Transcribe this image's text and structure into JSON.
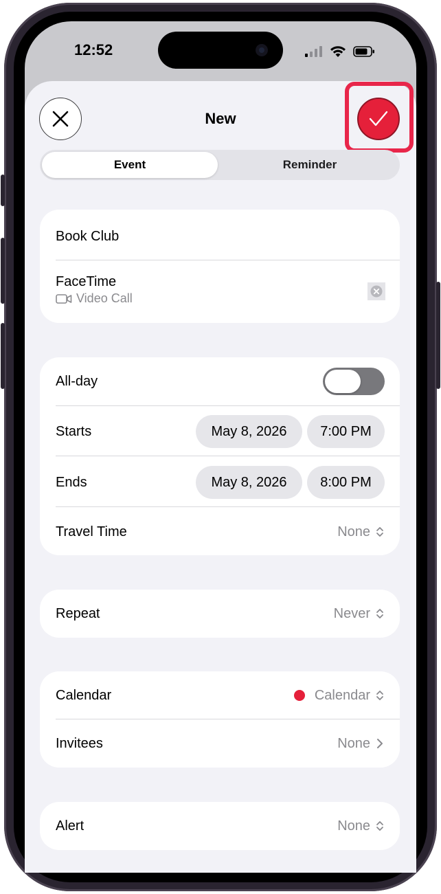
{
  "status_bar": {
    "time": "12:52"
  },
  "header": {
    "title": "New"
  },
  "segments": [
    {
      "label": "Event"
    },
    {
      "label": "Reminder"
    }
  ],
  "event": {
    "title": "Book Club",
    "location": "FaceTime",
    "location_detail": "Video Call"
  },
  "schedule": {
    "all_day_label": "All-day",
    "all_day_on": false,
    "starts_label": "Starts",
    "starts_date": "May 8, 2026",
    "starts_time": "7:00 PM",
    "ends_label": "Ends",
    "ends_date": "May 8, 2026",
    "ends_time": "8:00 PM",
    "travel_label": "Travel Time",
    "travel_value": "None"
  },
  "repeat": {
    "label": "Repeat",
    "value": "Never"
  },
  "calendar": {
    "label": "Calendar",
    "value": "Calendar",
    "color": "#e5203a",
    "invitees_label": "Invitees",
    "invitees_value": "None"
  },
  "alert": {
    "label": "Alert",
    "value": "None"
  },
  "colors": {
    "accent": "#e5203a",
    "highlight": "#e8264a"
  }
}
